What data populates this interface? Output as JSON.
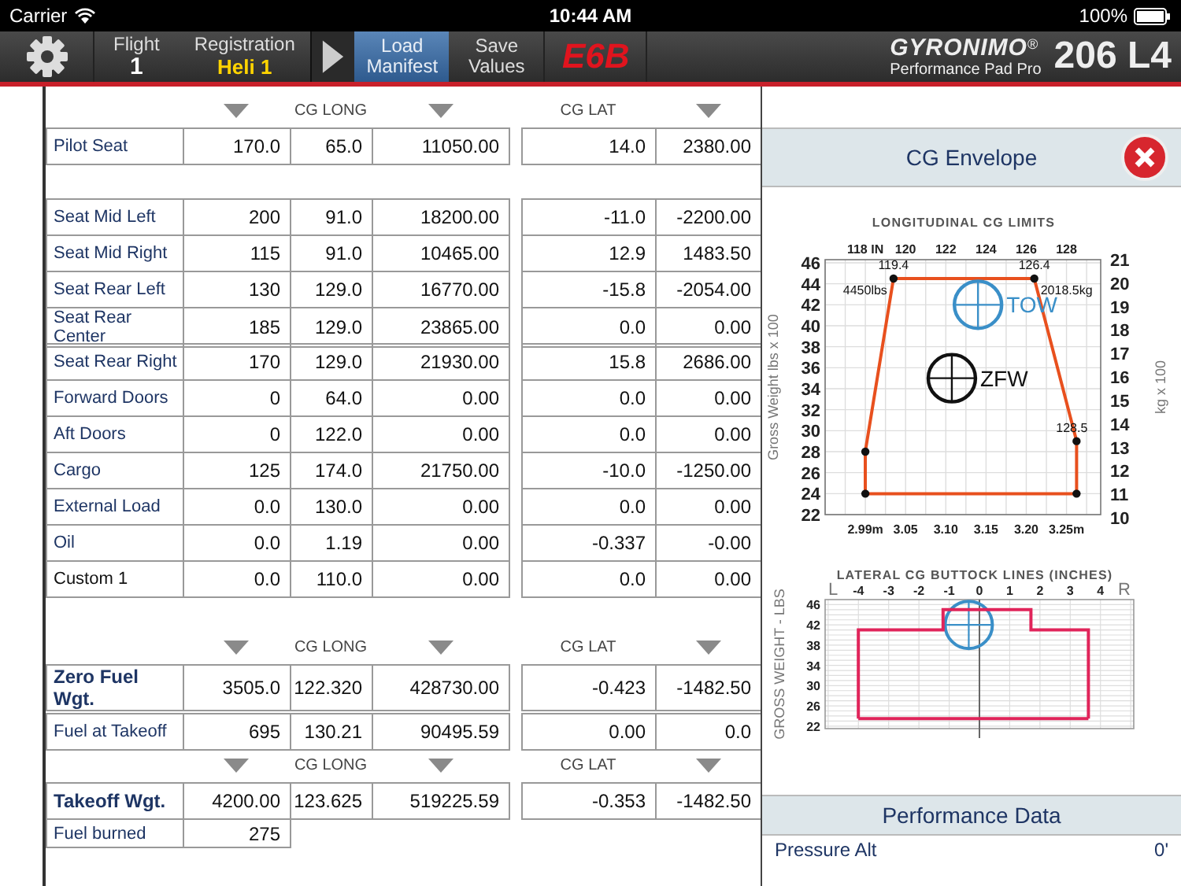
{
  "status_bar": {
    "carrier": "Carrier",
    "time": "10:44 AM",
    "battery": "100%"
  },
  "toolbar": {
    "flight_label": "Flight",
    "flight": "1",
    "registration_label": "Registration",
    "registration": "Heli 1",
    "buttons": [
      {
        "label": "Load Manifest",
        "selected": true
      },
      {
        "label": "Save Values",
        "selected": false
      }
    ],
    "e6b": "E6B",
    "brand": "GYRONIMO",
    "registered": "®",
    "subtitle": "Performance Pad Pro",
    "model": "206 L4"
  },
  "manifest": [
    {
      "kind": "header",
      "cg_long": "CG LONG",
      "cg_lat": "CG LAT"
    },
    {
      "kind": "item",
      "label": "Pilot Seat",
      "cells": [
        "170.0",
        "65.0",
        "11050.00",
        "14.0",
        "2380.00"
      ]
    },
    {
      "kind": "spacer"
    },
    {
      "kind": "item",
      "label": "Seat Mid Left",
      "cells": [
        "200",
        "91.0",
        "18200.00",
        "-11.0",
        "-2200.00"
      ]
    },
    {
      "kind": "item",
      "label": "Seat Mid Right",
      "cells": [
        "115",
        "91.0",
        "10465.00",
        "12.9",
        "1483.50"
      ]
    },
    {
      "kind": "item",
      "label": "Seat Rear Left",
      "cells": [
        "130",
        "129.0",
        "16770.00",
        "-15.8",
        "-2054.00"
      ]
    },
    {
      "kind": "item",
      "label": "Seat Rear Center",
      "cells": [
        "185",
        "129.0",
        "23865.00",
        "0.0",
        "0.00"
      ]
    },
    {
      "kind": "item",
      "label": "Seat Rear Right",
      "cells": [
        "170",
        "129.0",
        "21930.00",
        "15.8",
        "2686.00"
      ]
    },
    {
      "kind": "item",
      "label": "Forward Doors",
      "cells": [
        "0",
        "64.0",
        "0.00",
        "0.0",
        "0.00"
      ]
    },
    {
      "kind": "item",
      "label": "Aft Doors",
      "cells": [
        "0",
        "122.0",
        "0.00",
        "0.0",
        "0.00"
      ]
    },
    {
      "kind": "item",
      "label": "Cargo",
      "cells": [
        "125",
        "174.0",
        "21750.00",
        "-10.0",
        "-1250.00"
      ]
    },
    {
      "kind": "item",
      "label": "External Load",
      "cells": [
        "0.0",
        "130.0",
        "0.00",
        "0.0",
        "0.00"
      ]
    },
    {
      "kind": "item",
      "label": "Oil",
      "cells": [
        "0.0",
        "1.19",
        "0.00",
        "-0.337",
        "-0.00"
      ]
    },
    {
      "kind": "custom",
      "label": "Custom 1",
      "cells": [
        "0.0",
        "110.0",
        "0.00",
        "0.0",
        "0.00"
      ]
    },
    {
      "kind": "spacer"
    },
    {
      "kind": "header",
      "cg_long": "CG LONG",
      "cg_lat": "CG LAT"
    },
    {
      "kind": "total",
      "label": "Zero Fuel Wgt.",
      "cells": [
        "3505.0",
        "122.320",
        "428730.00",
        "-0.423",
        "-1482.50"
      ]
    },
    {
      "kind": "gap"
    },
    {
      "kind": "item",
      "label": "Fuel at Takeoff",
      "cells": [
        "695",
        "130.21",
        "90495.59",
        "0.00",
        "0.0"
      ]
    },
    {
      "kind": "header",
      "cg_long": "CG LONG",
      "cg_lat": "CG LAT"
    },
    {
      "kind": "total",
      "label": "Takeoff Wgt.",
      "cells": [
        "4200.00",
        "123.625",
        "519225.59",
        "-0.353",
        "-1482.50"
      ]
    },
    {
      "kind": "partial",
      "label": "Fuel burned",
      "cells": [
        "275"
      ]
    }
  ],
  "envelope_panel": {
    "title": "CG Envelope",
    "longitudinal": {
      "chart_data": {
        "type": "line",
        "title": "LONGITUDINAL CG LIMITS",
        "ylabel": "Gross Weight lbs x 100",
        "x": [
          118,
          118,
          119.4,
          126.4,
          128.5,
          128.5
        ],
        "series": [
          {
            "color": "#e8501e",
            "marker": true,
            "values": [
              24,
              28,
              44.5,
              44.5,
              29,
              24
            ]
          },
          {
            "color": "#e8501e",
            "values": [
              24,
              24,
              24,
              24,
              24,
              24
            ]
          }
        ],
        "grid": true,
        "xlim": [
          116,
          129.7
        ],
        "ylim": [
          22,
          46.3
        ],
        "xticks": [
          {
            "value": 118,
            "label": "118 IN"
          },
          120,
          122,
          124,
          126,
          128
        ],
        "yticks": [
          22,
          24,
          26,
          28,
          30,
          32,
          34,
          36,
          38,
          40,
          42,
          44,
          46
        ],
        "annotations": [
          {
            "text": "119.4",
            "x": 119.4,
            "y": 44.5
          },
          {
            "text": "4450lbs",
            "x": 119.4,
            "y": 44.5
          },
          {
            "text": "126.4",
            "x": 126.4,
            "y": 44.5
          },
          {
            "text": "2018.5kg",
            "x": 126.4,
            "y": 44.5
          },
          {
            "text": "128.5",
            "x": 128.5,
            "y": 29
          },
          {
            "text": "TOW",
            "x": 123.6,
            "y": 42
          },
          {
            "text": "ZFW",
            "x": 122.3,
            "y": 35
          }
        ]
      },
      "metre_ticks": [
        "2.99m",
        "3.05",
        "3.10",
        "3.15",
        "3.20",
        "3.25m"
      ],
      "kg_label": "kg x 100",
      "kg_ticks": [
        "21",
        "20",
        "19",
        "18",
        "17",
        "16",
        "15",
        "14",
        "13",
        "12",
        "11",
        "10"
      ]
    },
    "lateral": {
      "side_labels": [
        "L",
        "R"
      ],
      "chart_data": {
        "type": "line",
        "title": "LATERAL CG BUTTOCK LINES (INCHES)",
        "ylabel": "GROSS WEIGHT - LBS",
        "x": [
          -4,
          -4,
          -1.2,
          -1.2,
          1.7,
          1.7,
          3.6,
          3.6
        ],
        "series": [
          {
            "color": "#e0245a",
            "values": [
              23.5,
              41,
              41,
              45,
              45,
              41,
              41,
              23.5
            ]
          },
          {
            "color": "#e0245a",
            "values": [
              23.5,
              23.5,
              23.5,
              23.5,
              23.5,
              23.5,
              23.5,
              23.5
            ]
          }
        ],
        "grid": true,
        "xlim": [
          -5.1,
          5.1
        ],
        "ylim": [
          21.5,
          47
        ],
        "xticks": [
          -4,
          -3,
          -2,
          -1,
          0,
          1,
          2,
          3,
          4
        ],
        "yticks": [
          22,
          26,
          30,
          34,
          38,
          42,
          46
        ]
      }
    }
  },
  "performance_panel": {
    "title": "Performance Data",
    "rows": [
      {
        "label": "Pressure Alt",
        "value": "0'"
      }
    ]
  }
}
